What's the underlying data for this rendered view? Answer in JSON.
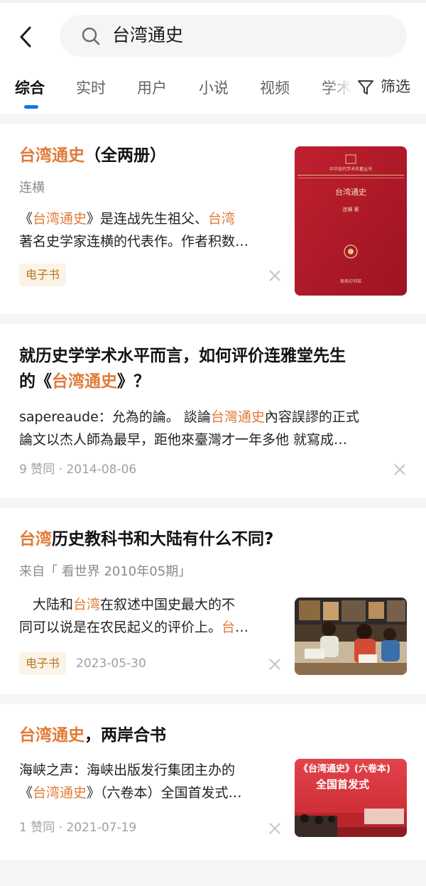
{
  "search": {
    "query": "台湾通史"
  },
  "tabs": [
    "综合",
    "实时",
    "用户",
    "小说",
    "视频",
    "学术"
  ],
  "filter": {
    "label": "筛选"
  },
  "colors": {
    "highlight": "#e07b39",
    "accent": "#1772f6",
    "tag_bg": "#fbf3e7",
    "tag_text": "#b5761f"
  },
  "results": [
    {
      "title": {
        "hl": "台湾通史",
        "rest": "（全两册）"
      },
      "author": "连横",
      "excerpt": {
        "l1a": "《",
        "l1b": "台湾通史",
        "l1c": "》是连战先生祖父、",
        "l1d": "台湾",
        "l2": "著名史学家连横的代表作。作者积数"
      },
      "tag": "电子书",
      "cover": {
        "series": "中华现代学术名著丛书",
        "title": "台湾通史",
        "author": "连横 著",
        "publisher": "商务印书馆"
      }
    },
    {
      "title": {
        "line1": "就历史学学术水平而言，如何评价连雅堂先生",
        "line2a": "的《",
        "line2b": "台湾通史",
        "line2c": "》？"
      },
      "excerpt": {
        "l1a": "sapereaude：允為的論。 談論",
        "l1b": "台灣通史",
        "l1c": "內容誤謬的正式",
        "l2": "論文以杰人師為最早，距他來臺灣才一年多他 就寫成"
      },
      "likes": "9 赞同",
      "date": "2014-08-06"
    },
    {
      "title": {
        "hl": "台湾",
        "rest": "历史教科书和大陆有什么不同?"
      },
      "source": "来自「 看世界 2010年05期」",
      "excerpt": {
        "l1a": "　大陆和",
        "l1b": "台湾",
        "l1c": "在叙述中国史最大的不",
        "l2a": "同可以说是在农民起义的评价上。",
        "l2b": "台"
      },
      "tag": "电子书",
      "date": "2023-05-30"
    },
    {
      "title": {
        "hl": "台湾通史",
        "rest": "，两岸合书"
      },
      "excerpt": {
        "l1": "海峡之声：海峡出版发行集团主办的",
        "l2a": "《",
        "l2b": "台湾通史",
        "l2c": "》（六卷本）全国首发式"
      },
      "likes": "1 赞同",
      "date": "2021-07-19",
      "banner": {
        "line1": "《台湾通史》(六卷本)",
        "line2": "全国首发式"
      }
    }
  ]
}
